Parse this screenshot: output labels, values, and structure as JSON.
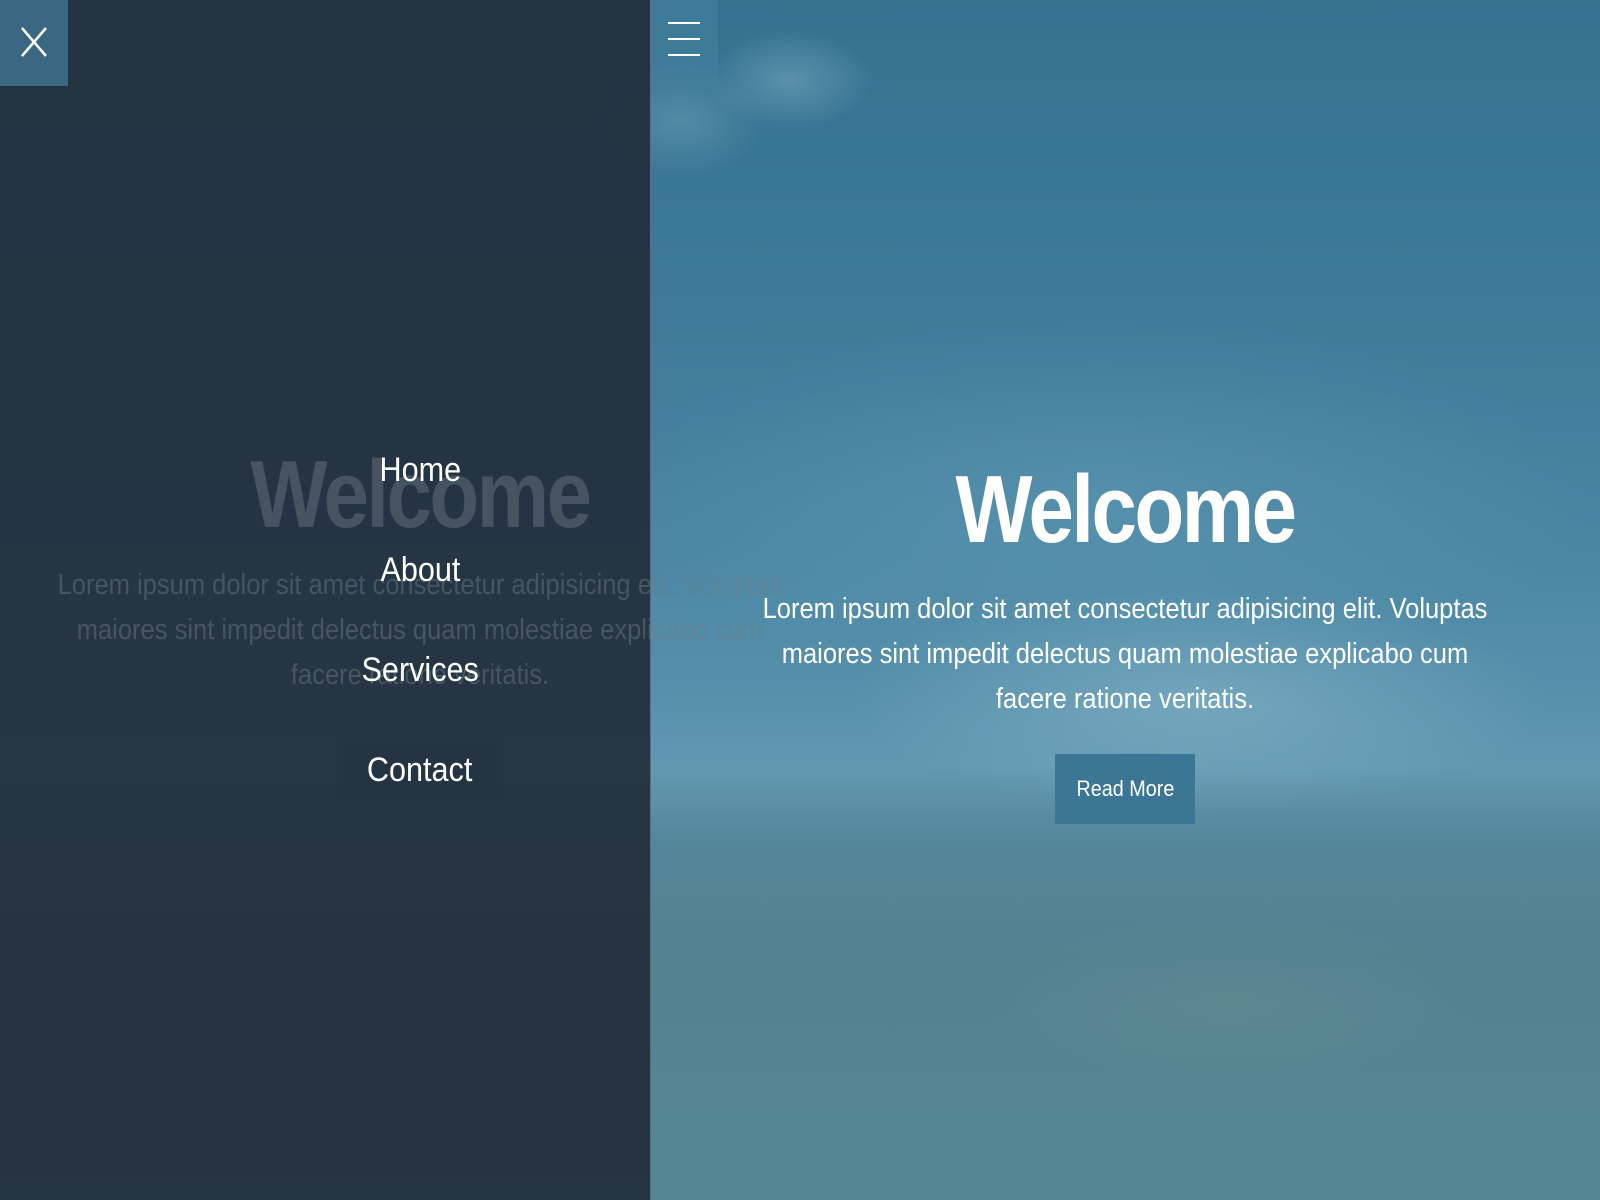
{
  "colors": {
    "nav_background": "#222e3c",
    "accent_button": "#3b7694",
    "close_button": "#3a6782",
    "text": "#ffffff"
  },
  "navigation": {
    "close_icon": "close-icon",
    "items": [
      {
        "label": "Home"
      },
      {
        "label": "About"
      },
      {
        "label": "Services"
      },
      {
        "label": "Contact"
      }
    ],
    "highlighted_item": "Contact"
  },
  "header": {
    "menu_icon": "hamburger-menu-icon"
  },
  "hero": {
    "title": "Welcome",
    "text": "Lorem ipsum dolor sit amet consectetur adipisicing elit. Voluptas maiores sint impedit delectus quam molestiae explicabo cum facere ratione veritatis.",
    "button_label": "Read More"
  },
  "ghost": {
    "title": "Welcome",
    "text": "Lorem ipsum dolor sit amet consectetur adipisicing elit. Voluptas maiores sint impedit delectus quam molestiae explicabo cum facere ratione veritatis."
  }
}
